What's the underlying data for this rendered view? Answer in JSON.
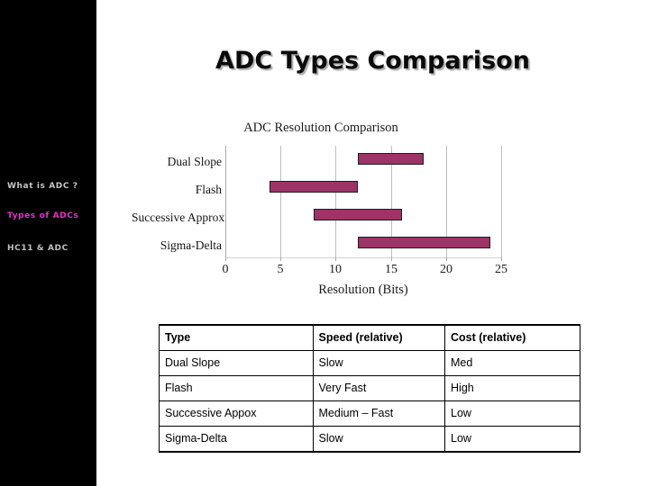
{
  "slide": {
    "title": "ADC Types Comparison",
    "background_color": "#ffffff"
  },
  "sidebar": {
    "background_color": "#000000",
    "active_color": "#e832c8",
    "inactive_color": "#c8c8c8",
    "items": [
      {
        "label": "What is ADC ?",
        "active": false
      },
      {
        "label": "Types of ADCs",
        "active": true
      },
      {
        "label": "HC11 & ADC",
        "active": false
      }
    ]
  },
  "chart_data": {
    "type": "bar",
    "orientation": "horizontal",
    "subtype": "floating-range-bar",
    "title": "ADC Resolution Comparison",
    "xlabel": "Resolution (Bits)",
    "ylabel": "",
    "categories": [
      "Dual Slope",
      "Flash",
      "Successive Approx",
      "Sigma-Delta"
    ],
    "ranges": [
      {
        "category": "Dual Slope",
        "start": 12,
        "end": 18
      },
      {
        "category": "Flash",
        "start": 4,
        "end": 12
      },
      {
        "category": "Successive Approx",
        "start": 8,
        "end": 16
      },
      {
        "category": "Sigma-Delta",
        "start": 12,
        "end": 24
      }
    ],
    "series": [
      {
        "name": "start",
        "values": [
          12,
          4,
          8,
          12
        ]
      },
      {
        "name": "span",
        "values": [
          6,
          8,
          8,
          12
        ]
      }
    ],
    "xlim": [
      0,
      25
    ],
    "xticks": [
      0,
      5,
      10,
      15,
      20,
      25
    ],
    "xtick_labels": [
      "0",
      "5",
      "10",
      "15",
      "20",
      "25"
    ],
    "grid": true,
    "legend": "none",
    "bar_color": "#9c3468",
    "bar_border_color": "#231a20",
    "gridline_color": "#bdbdbd"
  },
  "table": {
    "headers": [
      "Type",
      "Speed (relative)",
      "Cost (relative)"
    ],
    "rows": [
      [
        "Dual Slope",
        "Slow",
        "Med"
      ],
      [
        "Flash",
        "Very Fast",
        "High"
      ],
      [
        "Successive Appox",
        "Medium – Fast",
        "Low"
      ],
      [
        "Sigma-Delta",
        "Slow",
        "Low"
      ]
    ]
  }
}
